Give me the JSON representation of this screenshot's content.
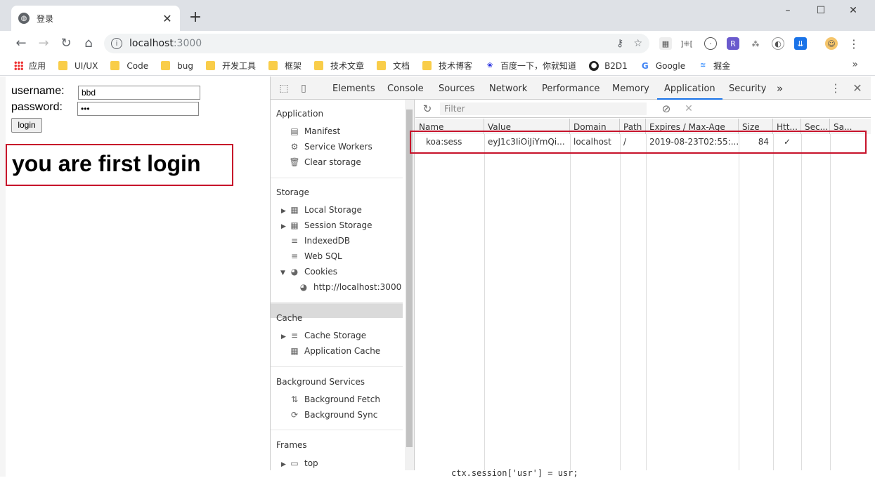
{
  "browser": {
    "tab_title": "登录",
    "tab_close": "✕",
    "new_tab": "+",
    "window_controls": [
      "–",
      "☐",
      "✕"
    ],
    "url_host": "localhost",
    "url_port": ":3000",
    "nav_icons": [
      "back-icon",
      "forward-icon",
      "reload-icon",
      "home-icon"
    ]
  },
  "bookmarks": [
    {
      "label": "应用",
      "icon": "apps-icon"
    },
    {
      "label": "UI/UX",
      "icon": "folder-icon"
    },
    {
      "label": "Code",
      "icon": "folder-icon"
    },
    {
      "label": "bug",
      "icon": "folder-icon"
    },
    {
      "label": "开发工具",
      "icon": "folder-icon"
    },
    {
      "label": "框架",
      "icon": "folder-icon"
    },
    {
      "label": "技术文章",
      "icon": "folder-icon"
    },
    {
      "label": "文档",
      "icon": "folder-icon"
    },
    {
      "label": "技术博客",
      "icon": "folder-icon"
    },
    {
      "label": "百度一下，你就知道",
      "icon": "baidu-icon"
    },
    {
      "label": "B2D1",
      "icon": "github-icon"
    },
    {
      "label": "Google",
      "icon": "google-icon"
    },
    {
      "label": "掘金",
      "icon": "juejin-icon"
    }
  ],
  "page": {
    "username_label": "username:",
    "username_value": "bbd",
    "password_label": "password:",
    "password_value": "•••",
    "login_button": "login",
    "message": "you are first login"
  },
  "devtools": {
    "tabs": [
      "Elements",
      "Console",
      "Sources",
      "Network",
      "Performance",
      "Memory",
      "Application",
      "Security"
    ],
    "active_tab": "Application",
    "more": "»",
    "filter_placeholder": "Filter",
    "sidebar": {
      "application_header": "Application",
      "manifest": "Manifest",
      "service_workers": "Service Workers",
      "clear_storage": "Clear storage",
      "storage_header": "Storage",
      "local_storage": "Local Storage",
      "session_storage": "Session Storage",
      "indexeddb": "IndexedDB",
      "web_sql": "Web SQL",
      "cookies": "Cookies",
      "cookie_origin": "http://localhost:3000",
      "cache_header": "Cache",
      "cache_storage": "Cache Storage",
      "application_cache": "Application Cache",
      "bg_header": "Background Services",
      "bg_fetch": "Background Fetch",
      "bg_sync": "Background Sync",
      "frames_header": "Frames",
      "top": "top"
    },
    "table": {
      "columns": [
        "Name",
        "Value",
        "Domain",
        "Path",
        "Expires / Max-Age",
        "Size",
        "Htt...",
        "Sec...",
        "Sa..."
      ],
      "rows": [
        [
          "koa:sess",
          "eyJ1c3IiOiJiYmQi...",
          "localhost",
          "/",
          "2019-08-23T02:55:...",
          "84",
          "✓",
          "",
          ""
        ]
      ]
    }
  },
  "code_snippet": "ctx.session['usr'] = usr;"
}
